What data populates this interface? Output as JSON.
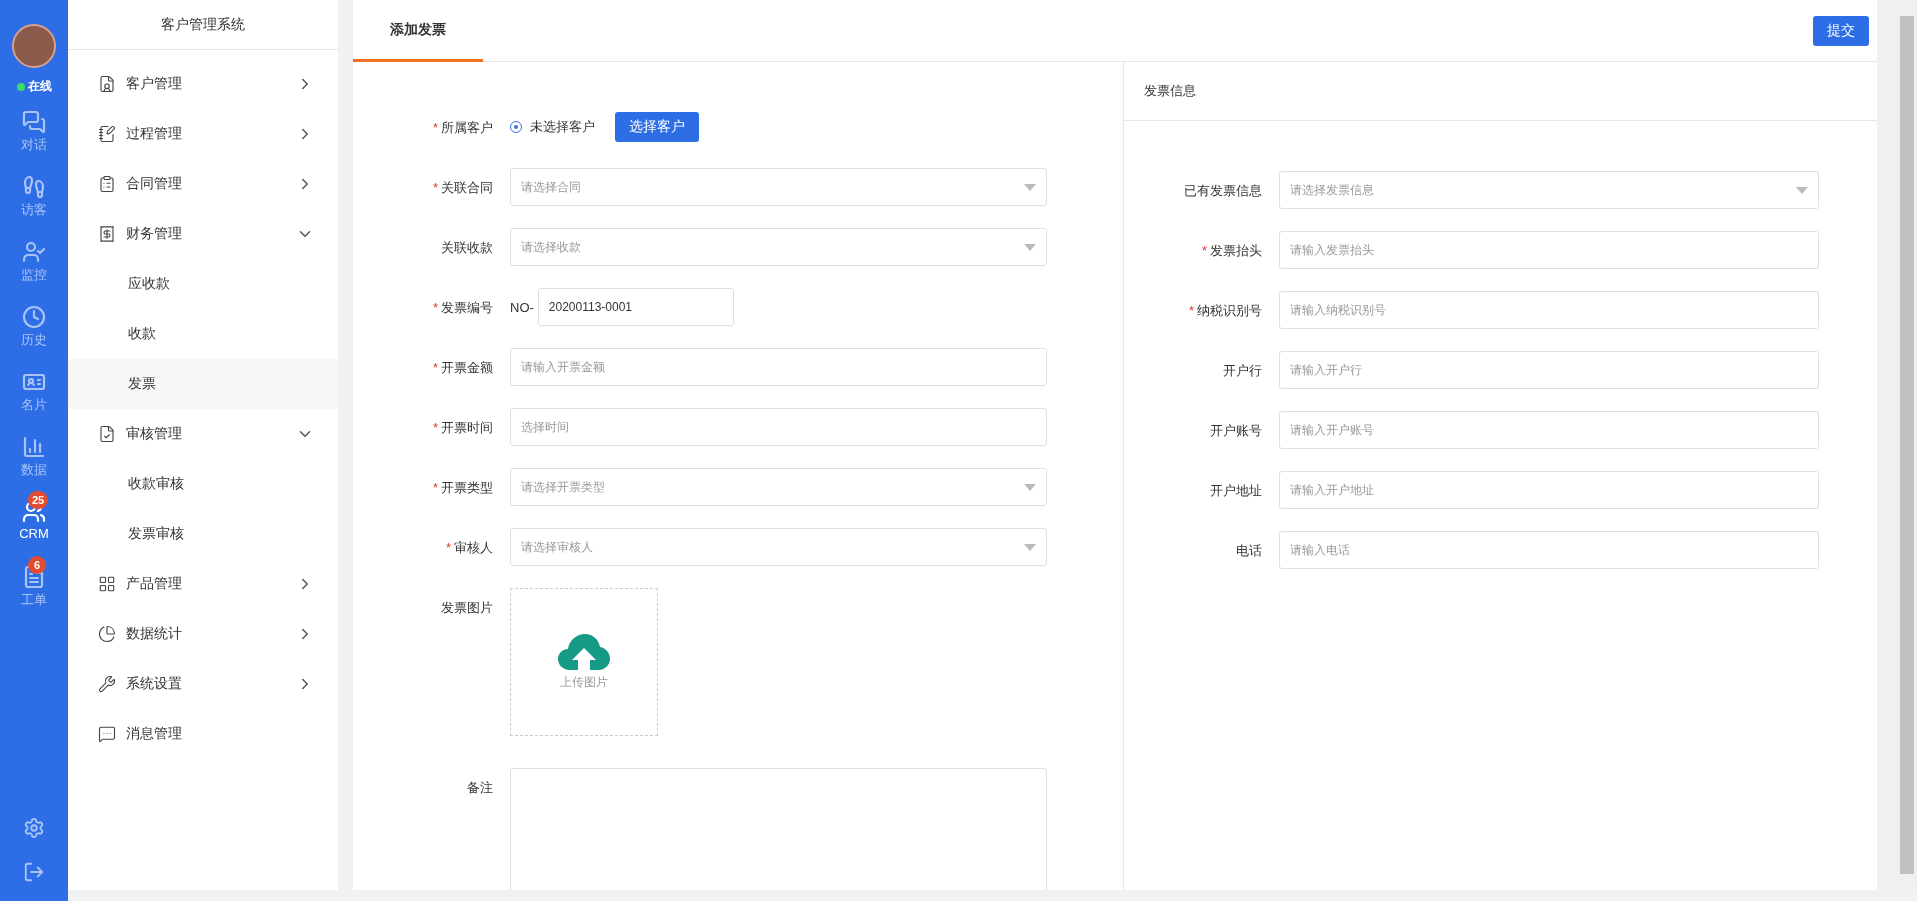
{
  "rail": {
    "status": {
      "label": "在线",
      "online": true
    },
    "items": [
      {
        "label": "对话",
        "selected": false
      },
      {
        "label": "访客",
        "selected": false
      },
      {
        "label": "监控",
        "selected": false
      },
      {
        "label": "历史",
        "selected": false
      },
      {
        "label": "名片",
        "selected": false
      },
      {
        "label": "数据",
        "selected": false
      },
      {
        "label": "CRM",
        "selected": true,
        "badge": "25"
      },
      {
        "label": "工单",
        "selected": false,
        "badge": "6"
      }
    ]
  },
  "sidebar": {
    "title": "客户管理系统",
    "items": [
      {
        "label": "客户管理",
        "kind": "group",
        "expanded": false
      },
      {
        "label": "过程管理",
        "kind": "group",
        "expanded": false
      },
      {
        "label": "合同管理",
        "kind": "group",
        "expanded": false
      },
      {
        "label": "财务管理",
        "kind": "group",
        "expanded": true,
        "children": [
          {
            "label": "应收款",
            "selected": false
          },
          {
            "label": "收款",
            "selected": false
          },
          {
            "label": "发票",
            "selected": true
          }
        ]
      },
      {
        "label": "审核管理",
        "kind": "group",
        "expanded": true,
        "children": [
          {
            "label": "收款审核",
            "selected": false
          },
          {
            "label": "发票审核",
            "selected": false
          }
        ]
      },
      {
        "label": "产品管理",
        "kind": "group",
        "expanded": false
      },
      {
        "label": "数据统计",
        "kind": "group",
        "expanded": false
      },
      {
        "label": "系统设置",
        "kind": "group",
        "expanded": false
      },
      {
        "label": "消息管理",
        "kind": "link"
      }
    ]
  },
  "tabs": [
    {
      "label": "添加发票",
      "selected": true
    }
  ],
  "submit_button": "提交",
  "form": {
    "fields": [
      {
        "label": "所属客户",
        "mark": "*",
        "kind": "radio",
        "option": {
          "label": "未选择客户",
          "checked": true
        },
        "button": "选择客户"
      },
      {
        "label": "关联合同",
        "mark": "*",
        "kind": "select",
        "placeholder": "请选择合同"
      },
      {
        "label": "关联收款",
        "kind": "select",
        "placeholder": "请选择收款"
      },
      {
        "label": "发票编号",
        "mark": "*",
        "kind": "prefixed",
        "prefix": "NO-",
        "value": "20200113-0001"
      },
      {
        "label": "开票金额",
        "mark": "*",
        "kind": "input",
        "placeholder": "请输入开票金额"
      },
      {
        "label": "开票时间",
        "mark": "*",
        "kind": "input",
        "placeholder": "选择时间"
      },
      {
        "label": "开票类型",
        "mark": "*",
        "kind": "select",
        "placeholder": "请选择开票类型"
      },
      {
        "label": "审核人",
        "mark": "*",
        "kind": "select",
        "placeholder": "请选择审核人"
      },
      {
        "label": "发票图片",
        "kind": "upload",
        "text": "上传图片"
      },
      {
        "label": "备注",
        "kind": "textarea"
      }
    ]
  },
  "invoice_info": {
    "title": "发票信息",
    "fields": [
      {
        "label": "已有发票信息",
        "kind": "select",
        "placeholder": "请选择发票信息"
      },
      {
        "label": "发票抬头",
        "mark": "*",
        "kind": "input",
        "placeholder": "请输入发票抬头"
      },
      {
        "label": "纳税识别号",
        "mark": "*",
        "kind": "input",
        "placeholder": "请输入纳税识别号"
      },
      {
        "label": "开户行",
        "kind": "input",
        "placeholder": "请输入开户行"
      },
      {
        "label": "开户账号",
        "kind": "input",
        "placeholder": "请输入开户账号"
      },
      {
        "label": "开户地址",
        "kind": "input",
        "placeholder": "请输入开户地址"
      },
      {
        "label": "电话",
        "kind": "input",
        "placeholder": "请输入电话"
      }
    ]
  }
}
